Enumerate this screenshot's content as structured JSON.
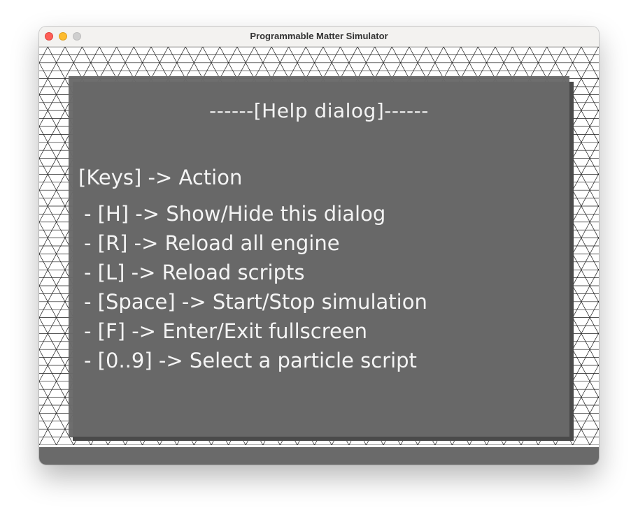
{
  "window": {
    "title": "Programmable Matter Simulator",
    "controls": [
      "close",
      "minimize",
      "zoom"
    ]
  },
  "canvas": {
    "grid": "triangular-lattice",
    "grid_color": "#1a1a1a",
    "background_color": "#ffffff"
  },
  "help_dialog": {
    "title": "------[Help dialog]------",
    "keys_header": "[Keys] -> Action",
    "items": [
      {
        "text": "- [H] -> Show/Hide this dialog"
      },
      {
        "text": "- [R] -> Reload all engine"
      },
      {
        "text": "- [L] -> Reload scripts"
      },
      {
        "text": "- [Space] -> Start/Stop simulation"
      },
      {
        "text": "- [F] -> Enter/Exit fullscreen"
      },
      {
        "text": "- [0..9] -> Select a particle script"
      }
    ],
    "background_color": "#696969",
    "text_color": "#f4f4f4"
  }
}
